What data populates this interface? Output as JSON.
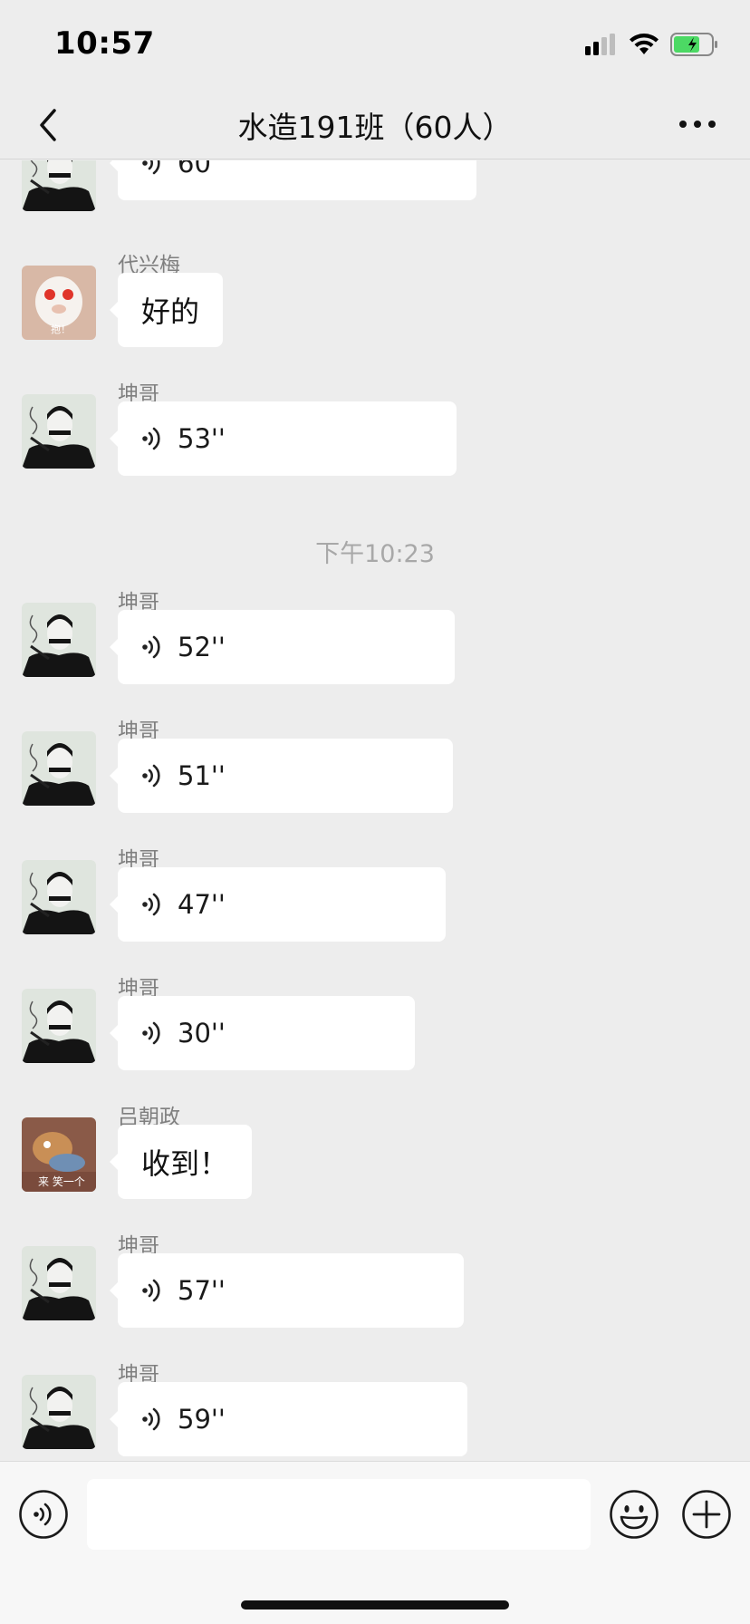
{
  "status_bar": {
    "time": "10:57"
  },
  "nav": {
    "title": "水造191班（60人）"
  },
  "messages": [
    {
      "sender": "",
      "type": "voice",
      "duration": "60''",
      "avatar": "portrait-avatar"
    },
    {
      "sender": "代兴梅",
      "type": "text",
      "text": "好的",
      "avatar": "cat-avatar"
    },
    {
      "sender": "坤哥",
      "type": "voice",
      "duration": "53''",
      "avatar": "portrait-avatar"
    },
    {
      "sender": "坤哥",
      "type": "voice",
      "duration": "52''",
      "avatar": "portrait-avatar"
    },
    {
      "sender": "坤哥",
      "type": "voice",
      "duration": "51''",
      "avatar": "portrait-avatar"
    },
    {
      "sender": "坤哥",
      "type": "voice",
      "duration": "47''",
      "avatar": "portrait-avatar"
    },
    {
      "sender": "坤哥",
      "type": "voice",
      "duration": "30''",
      "avatar": "portrait-avatar"
    },
    {
      "sender": "吕朝政",
      "type": "text",
      "text": "收到！",
      "avatar": "cartoon-avatar"
    },
    {
      "sender": "坤哥",
      "type": "voice",
      "duration": "57''",
      "avatar": "portrait-avatar"
    },
    {
      "sender": "坤哥",
      "type": "voice",
      "duration": "59''",
      "avatar": "portrait-avatar"
    }
  ],
  "timestamp": "下午10:23",
  "avatar_text": {
    "cat": "抱！",
    "cartoon": "来 笑一个"
  },
  "input": {
    "placeholder": ""
  },
  "colors": {
    "background": "#ededed",
    "bubble": "#ffffff",
    "battery": "#4cd964"
  },
  "icons": [
    "back-arrow-icon",
    "more-dots-icon",
    "signal-icon",
    "wifi-icon",
    "battery-icon",
    "voice-wave-icon",
    "voice-input-icon",
    "emoji-icon",
    "plus-icon"
  ]
}
